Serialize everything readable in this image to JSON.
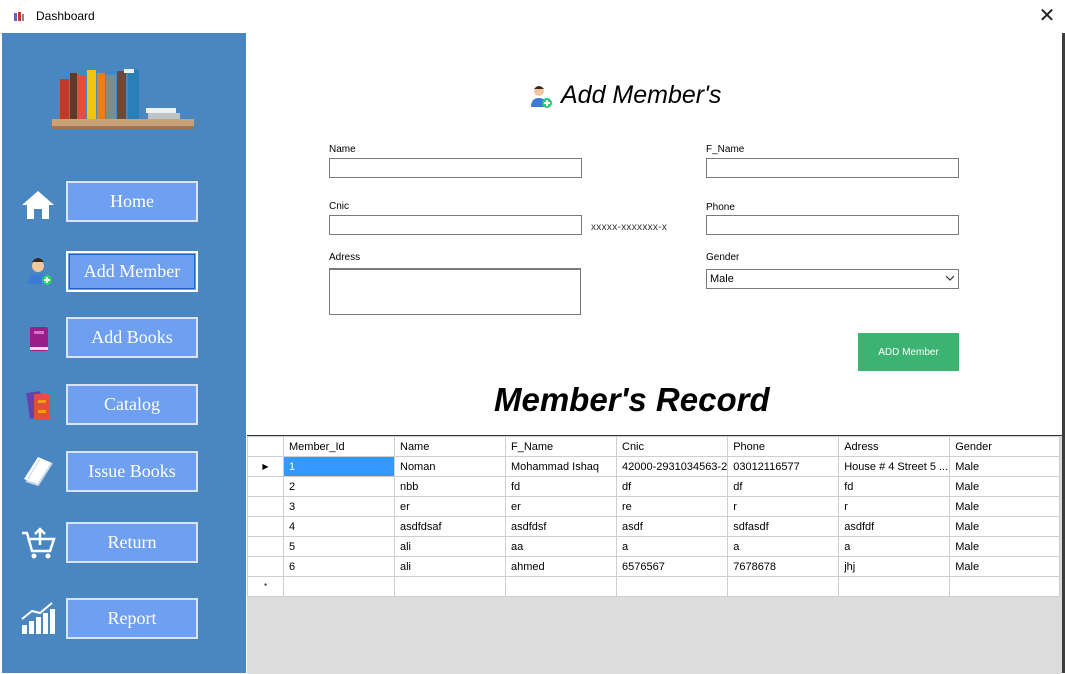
{
  "window": {
    "title": "Dashboard",
    "close_glyph": "✕"
  },
  "sidebar": {
    "items": [
      {
        "label": "Home",
        "icon": "home-icon"
      },
      {
        "label": "Add Member",
        "icon": "add-user-icon"
      },
      {
        "label": "Add Books",
        "icon": "book-icon"
      },
      {
        "label": "Catalog",
        "icon": "catalog-icon"
      },
      {
        "label": "Issue Books",
        "icon": "issue-books-icon"
      },
      {
        "label": "Return",
        "icon": "return-cart-icon"
      },
      {
        "label": "Report",
        "icon": "report-chart-icon"
      }
    ],
    "accent_color": "#4a86c0",
    "button_color": "#6f9ff0"
  },
  "form": {
    "title": "Add Member's",
    "name_label": "Name",
    "fname_label": "F_Name",
    "cnic_label": "Cnic",
    "cnic_hint": "xxxxx-xxxxxxx-x",
    "phone_label": "Phone",
    "address_label": "Adress",
    "gender_label": "Gender",
    "gender_value": "Male",
    "submit_label": "ADD Member",
    "submit_color": "#3cb371"
  },
  "record": {
    "title": "Member's Record",
    "columns": [
      "Member_Id",
      "Name",
      "F_Name",
      "Cnic",
      "Phone",
      "Adress",
      "Gender"
    ],
    "rows": [
      [
        "1",
        "Noman",
        "Mohammad Ishaq",
        "42000-2931034563-2",
        "03012116577",
        "House # 4 Street 5 ...",
        "Male"
      ],
      [
        "2",
        "nbb",
        "fd",
        "df",
        "df",
        "fd",
        "Male"
      ],
      [
        "3",
        "er",
        "er",
        "re",
        "r",
        "r",
        "Male"
      ],
      [
        "4",
        "asdfdsaf",
        "asdfdsf",
        "asdf",
        "sdfasdf",
        "asdfdf",
        "Male"
      ],
      [
        "5",
        "ali",
        "aa",
        "a",
        "a",
        "a",
        "Male"
      ],
      [
        "6",
        "ali",
        "ahmed",
        "6576567",
        "7678678",
        "jhj",
        "Male"
      ]
    ],
    "selected_marker": "▶",
    "new_row_marker": "*"
  }
}
